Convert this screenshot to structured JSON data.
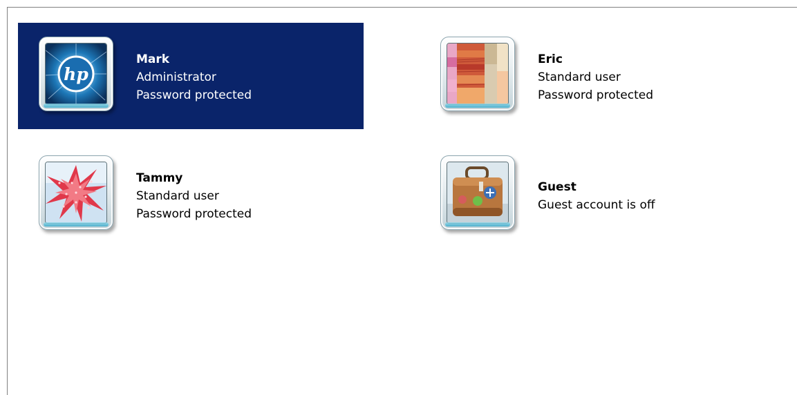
{
  "accounts": [
    {
      "name": "Mark",
      "lines": [
        "Administrator",
        "Password protected"
      ],
      "picture": "hp-logo-picture",
      "selected": true
    },
    {
      "name": "Eric",
      "lines": [
        "Standard user",
        "Password protected"
      ],
      "picture": "fabric-picture",
      "selected": false
    },
    {
      "name": "Tammy",
      "lines": [
        "Standard user",
        "Password protected"
      ],
      "picture": "starburst-picture",
      "selected": false
    },
    {
      "name": "Guest",
      "lines": [
        "Guest account is off"
      ],
      "picture": "suitcase-picture",
      "selected": false
    }
  ],
  "colors": {
    "selection": "#0a246a",
    "panel_border": "#808080",
    "background": "#ffffff"
  }
}
